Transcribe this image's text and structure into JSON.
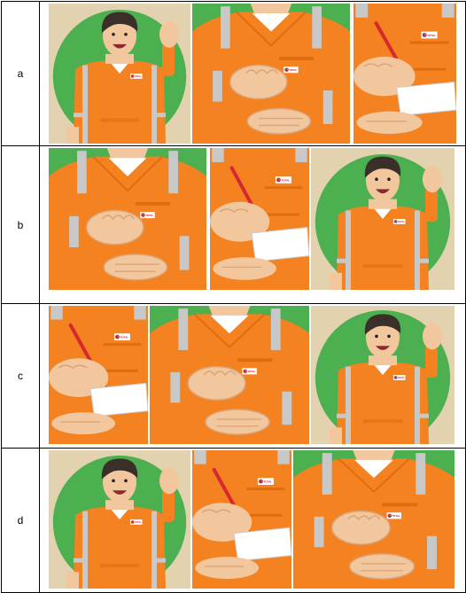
{
  "rows": [
    {
      "label": "a",
      "panels": [
        "wave",
        "hands",
        "sign"
      ]
    },
    {
      "label": "b",
      "panels": [
        "hands",
        "sign",
        "wave"
      ]
    },
    {
      "label": "c",
      "panels": [
        "sign",
        "hands",
        "wave"
      ]
    },
    {
      "label": "d",
      "panels": [
        "wave",
        "sign",
        "hands"
      ]
    }
  ],
  "badge_text": "TOTAL",
  "colors": {
    "suit_orange": "#f58220",
    "suit_dark": "#e06c10",
    "reflective": "#c8c8c8",
    "background_green": "#4caf50",
    "background_beige": "#e2d2b0",
    "skin": "#f3c79e",
    "hair": "#3b2f2a",
    "pen_red": "#d7282f"
  },
  "icons": {
    "wave": "worker-waving-icon",
    "hands": "worker-hands-clasped-icon",
    "sign": "worker-signing-paper-icon"
  }
}
